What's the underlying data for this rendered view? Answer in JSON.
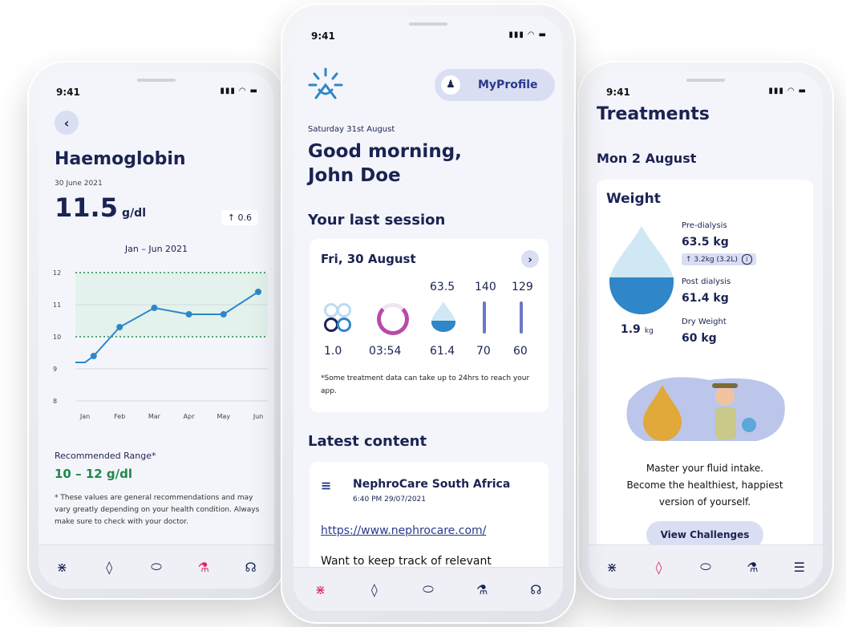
{
  "colors": {
    "navy": "#1a2352",
    "accent": "#e0245e",
    "blue": "#2f86c9",
    "green": "#1f8a4a",
    "chip": "#d9def2"
  },
  "left": {
    "time": "9:41",
    "title": "Haemoglobin",
    "date": "30 June 2021",
    "value": "11.5",
    "unit": "g/dl",
    "change": "↑ 0.6",
    "period": "Jan – Jun 2021",
    "range_label": "Recommended Range*",
    "range_value": "10 – 12 g/dl",
    "note": "* These values are general recommendations and may vary greatly depending on your health condition. Always make sure to check with your doctor."
  },
  "chart_data": {
    "type": "line",
    "categories": [
      "Jan",
      "Feb",
      "Mar",
      "Apr",
      "May",
      "Jun"
    ],
    "x": [
      0,
      0.25,
      1,
      2,
      3,
      4,
      5
    ],
    "values": [
      9.2,
      9.4,
      10.3,
      10.9,
      10.7,
      10.7,
      11.4
    ],
    "ylim": [
      8,
      12
    ],
    "yticks": [
      12,
      11,
      10,
      9,
      8
    ],
    "range_band": [
      10,
      12
    ],
    "grid": true
  },
  "center": {
    "time": "9:41",
    "profile_label": "MyProfile",
    "date": "Saturday 31st August",
    "greeting_line1": "Good morning,",
    "greeting_line2": "John Doe",
    "last_session_heading": "Your last session",
    "session_date": "Fri, 30 August",
    "metrics": [
      {
        "top": "",
        "bottom": "1.0",
        "icon": "circles-icon"
      },
      {
        "top": "",
        "bottom": "03:54",
        "icon": "ring-timer-icon"
      },
      {
        "top": "63.5",
        "bottom": "61.4",
        "icon": "drop-icon"
      },
      {
        "top": "140",
        "bottom": "70",
        "icon": "bar-icon"
      },
      {
        "top": "129",
        "bottom": "60",
        "icon": "bar-icon"
      }
    ],
    "session_note": "*Some treatment data can take up to 24hrs to reach your app.",
    "latest_heading": "Latest content",
    "post_author": "NephroCare South Africa",
    "post_time": "6:40 PM 29/07/2021",
    "post_link": "https://www.nephrocare.com/",
    "post_text": "Want to keep track of relevant"
  },
  "right": {
    "time": "9:41",
    "title": "Treatments",
    "date": "Mon 2 August",
    "weight_heading": "Weight",
    "pre_label": "Pre-dialysis",
    "pre_value": "63.5 kg",
    "pre_change": "↑ 3.2kg (3.2L)",
    "post_label": "Post dialysis",
    "post_value": "61.4 kg",
    "diff_value": "1.9",
    "diff_unit": "kg",
    "dry_label": "Dry Weight",
    "dry_value": "60 kg",
    "promo_line1": "Master your fluid intake.",
    "promo_line2": "Become the healthiest, happiest",
    "promo_line3": "version of yourself.",
    "button_label": "View Challenges"
  },
  "tabs": [
    "home-sun-icon",
    "drop-icon",
    "pill-icon",
    "flask-icon",
    "kidney-icon"
  ],
  "tabs_right": [
    "home-sun-icon",
    "drop-icon",
    "pill-icon",
    "flask-icon",
    "document-icon"
  ]
}
